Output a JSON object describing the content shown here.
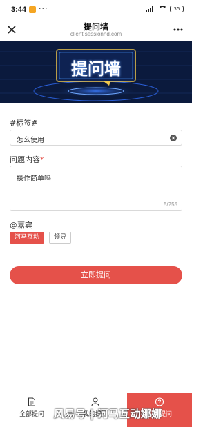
{
  "status": {
    "time": "3:44",
    "dots": "···",
    "battery": "35"
  },
  "header": {
    "title": "提问墙",
    "subtitle": "client.sessionhd.com"
  },
  "banner": {
    "title": "提问墙"
  },
  "form": {
    "tag_label": "#标签#",
    "tag_value": "怎么使用",
    "question_label": "问题内容",
    "required_mark": "*",
    "question_value": "操作简单吗",
    "counter": "5/255",
    "guest_label": "@嘉宾",
    "guests": [
      "河马互动",
      "领导"
    ],
    "submit_label": "立即提问"
  },
  "tabs": [
    {
      "label": "全部提问",
      "icon": "document-icon"
    },
    {
      "label": "我的提问",
      "icon": "person-icon"
    },
    {
      "label": "我要提问",
      "icon": "question-icon"
    }
  ],
  "watermark": "风易号 | 河马互动娜娜",
  "colors": {
    "accent": "#e5514a",
    "banner_bg": "#0b1a3d",
    "banner_frame": "#f2c94c"
  }
}
